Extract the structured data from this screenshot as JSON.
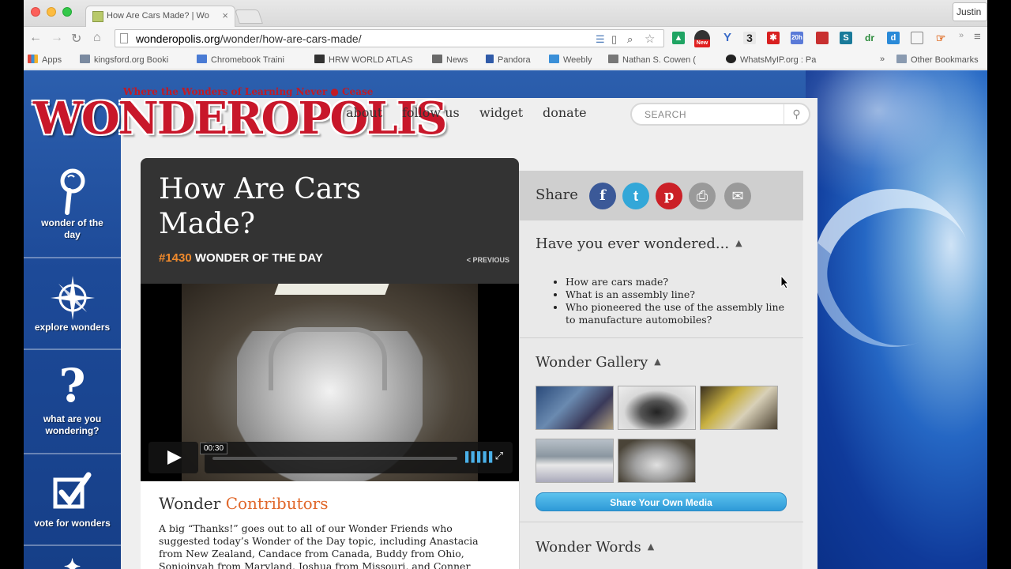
{
  "browser": {
    "tab_title": "How Are Cars Made? | Wo",
    "tab_close": "×",
    "profile_name": "Justin",
    "url_host": "wonderopolis.org",
    "url_path": "/wonder/how-are-cars-made/",
    "extension_badges": [
      "New",
      "3",
      "20h"
    ],
    "overflow_chevron": "»",
    "bookmarks": [
      {
        "label": "Apps",
        "color": "#e2463a"
      },
      {
        "label": "kingsford.org Booki",
        "color": "#7a8aa0"
      },
      {
        "label": "Chromebook Traini",
        "color": "#4a7bd4"
      },
      {
        "label": "HRW WORLD ATLAS",
        "color": "#333333"
      },
      {
        "label": "News",
        "color": "#6a6a6a"
      },
      {
        "label": "Pandora",
        "color": "#2f5aa8"
      },
      {
        "label": "Weebly",
        "color": "#3a8fd8"
      },
      {
        "label": "Nathan S. Cowen (",
        "color": "#777777"
      },
      {
        "label": "WhatsMyIP.org : Pa",
        "color": "#222222"
      },
      {
        "label": "Other Bookmarks",
        "color": "#8a9ab0"
      }
    ],
    "bookmarks_overflow": "»"
  },
  "site": {
    "logo_tagline": "Where the Wonders of Learning Never ● Cease",
    "logo_word": "WONDEROPOLIS",
    "nav": [
      "about",
      "follow us",
      "widget",
      "donate"
    ],
    "search_placeholder": "SEARCH",
    "sidebar": [
      {
        "label": "wonder of the day",
        "icon": "magnifier-icon"
      },
      {
        "label": "explore wonders",
        "icon": "compass-icon"
      },
      {
        "label": "what are you wondering?",
        "icon": "question-icon"
      },
      {
        "label": "vote for wonders",
        "icon": "checkbox-icon"
      }
    ]
  },
  "wonder": {
    "title": "How Are Cars Made?",
    "number": "#1430",
    "of_the_day": "WONDER OF THE DAY",
    "previous": "< PREVIOUS",
    "video_time": "00:30",
    "contrib_heading_a": "Wonder",
    "contrib_heading_b": "Contributors",
    "contrib_text": "A big “Thanks!” goes out to all of our Wonder Friends who suggested today’s Wonder of the Day topic, including Anastacia from New Zealand, Candace from Canada, Buddy from Ohio, Sonjoinyah from Maryland, Joshua from Missouri, and Conner from Indiana!"
  },
  "sidebar_right": {
    "share_label": "Share",
    "share_buttons": [
      {
        "name": "facebook",
        "glyph": "f",
        "color": "#3b5998"
      },
      {
        "name": "twitter",
        "glyph": "t",
        "color": "#33a7d8"
      },
      {
        "name": "pinterest",
        "glyph": "p",
        "color": "#cb2027"
      },
      {
        "name": "print",
        "glyph": "⎙",
        "color": "#9a9a9a"
      },
      {
        "name": "email",
        "glyph": "✉",
        "color": "#9a9a9a"
      }
    ],
    "wondered_heading": "Have you ever wondered...",
    "wondered_items": [
      "How are cars made?",
      "What is an assembly line?",
      "Who pioneered the use of the assembly line to manufacture automobiles?"
    ],
    "gallery_heading": "Wonder Gallery",
    "share_media": "Share Your Own Media",
    "words_heading": "Wonder Words",
    "collapse_glyph": "▲"
  },
  "colors": {
    "brand_red": "#c8172a",
    "accent_orange": "#f08a2c",
    "ocean_blue": "#1d4a98"
  }
}
